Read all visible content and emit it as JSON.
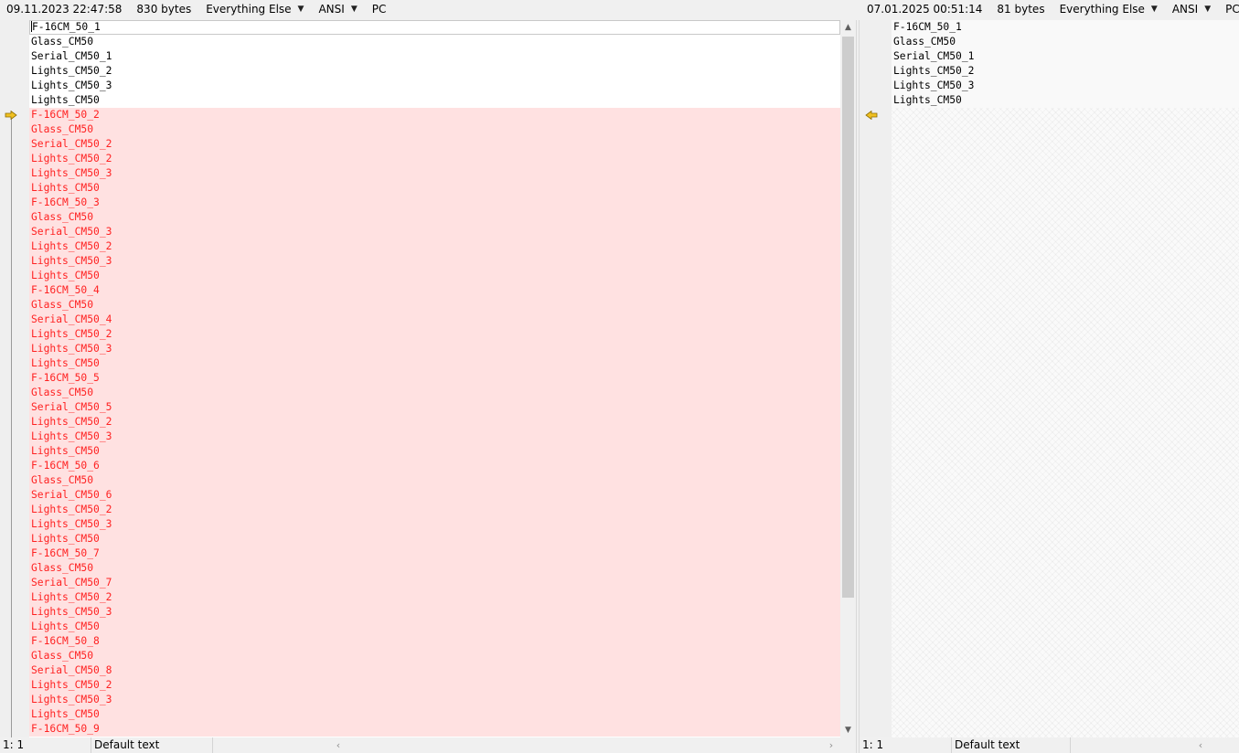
{
  "left_info": {
    "timestamp": "09.11.2023 22:47:58",
    "size": "830 bytes",
    "syntax": "Everything Else",
    "encoding": "ANSI",
    "line_endings": "PC"
  },
  "right_info": {
    "timestamp": "07.01.2025 00:51:14",
    "size": "81 bytes",
    "syntax": "Everything Else",
    "encoding": "ANSI",
    "line_endings": "PC"
  },
  "left_lines": [
    "F-16CM_50_1",
    "Glass_CM50",
    "Serial_CM50_1",
    "Lights_CM50_2",
    "Lights_CM50_3",
    "Lights_CM50",
    "F-16CM_50_2",
    "Glass_CM50",
    "Serial_CM50_2",
    "Lights_CM50_2",
    "Lights_CM50_3",
    "Lights_CM50",
    "F-16CM_50_3",
    "Glass_CM50",
    "Serial_CM50_3",
    "Lights_CM50_2",
    "Lights_CM50_3",
    "Lights_CM50",
    "F-16CM_50_4",
    "Glass_CM50",
    "Serial_CM50_4",
    "Lights_CM50_2",
    "Lights_CM50_3",
    "Lights_CM50",
    "F-16CM_50_5",
    "Glass_CM50",
    "Serial_CM50_5",
    "Lights_CM50_2",
    "Lights_CM50_3",
    "Lights_CM50",
    "F-16CM_50_6",
    "Glass_CM50",
    "Serial_CM50_6",
    "Lights_CM50_2",
    "Lights_CM50_3",
    "Lights_CM50",
    "F-16CM_50_7",
    "Glass_CM50",
    "Serial_CM50_7",
    "Lights_CM50_2",
    "Lights_CM50_3",
    "Lights_CM50",
    "F-16CM_50_8",
    "Glass_CM50",
    "Serial_CM50_8",
    "Lights_CM50_2",
    "Lights_CM50_3",
    "Lights_CM50",
    "F-16CM_50_9"
  ],
  "left_diff_start": 6,
  "right_lines": [
    "F-16CM_50_1",
    "Glass_CM50",
    "Serial_CM50_1",
    "Lights_CM50_2",
    "Lights_CM50_3",
    "Lights_CM50"
  ],
  "status_left": {
    "position": "1: 1",
    "style": "Default text"
  },
  "status_right": {
    "position": "1: 1",
    "style": "Default text"
  },
  "icons": {
    "dropdown": "triangle-down-icon",
    "diff_marker_left": "arrow-right-icon",
    "diff_marker_right": "arrow-left-icon",
    "scroll_up": "triangle-up-icon",
    "scroll_down": "triangle-down-icon",
    "scroll_left": "chevron-left-icon",
    "scroll_right": "chevron-right-icon"
  },
  "colors": {
    "diff_text": "#ff2222",
    "diff_background": "#ffe1e1",
    "marker": "#f0c020"
  }
}
